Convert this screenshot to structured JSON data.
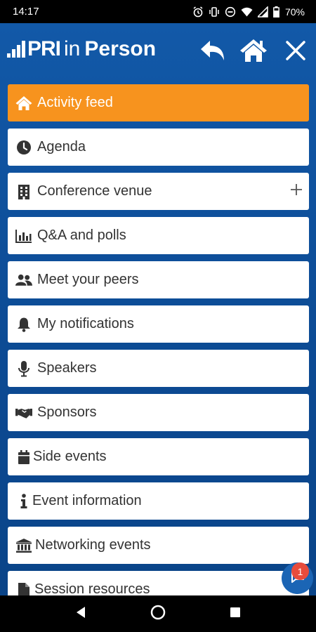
{
  "status_bar": {
    "time": "14:17",
    "battery": "70%",
    "icons": [
      "alarm-icon",
      "vibrate-icon",
      "dnd-icon",
      "wifi-icon",
      "signal-icon",
      "battery-icon"
    ]
  },
  "header": {
    "logo": {
      "pri": "PRI",
      "in": "in",
      "person": "Person"
    },
    "buttons": [
      "back-icon",
      "home-icon",
      "close-icon"
    ]
  },
  "menu": {
    "items": [
      {
        "label": "Activity feed",
        "icon": "home-icon",
        "active": true
      },
      {
        "label": "Agenda",
        "icon": "clock-icon"
      },
      {
        "label": "Conference venue",
        "icon": "building-icon",
        "expandable": true
      },
      {
        "label": "Q&A and polls",
        "icon": "bar-chart-icon"
      },
      {
        "label": "Meet your peers",
        "icon": "users-icon"
      },
      {
        "label": "My notifications",
        "icon": "bell-icon"
      },
      {
        "label": "Speakers",
        "icon": "microphone-icon"
      },
      {
        "label": "Sponsors",
        "icon": "handshake-icon"
      },
      {
        "label": "Side events",
        "icon": "calendar-icon"
      },
      {
        "label": "Event information",
        "icon": "info-icon"
      },
      {
        "label": "Networking events",
        "icon": "institution-icon"
      },
      {
        "label": "Session resources",
        "icon": "file-icon"
      }
    ]
  },
  "chat": {
    "badge_count": "1"
  },
  "colors": {
    "brand_blue": "#0d4a8f",
    "active_orange": "#f7931e",
    "badge_red": "#e74c3c"
  }
}
